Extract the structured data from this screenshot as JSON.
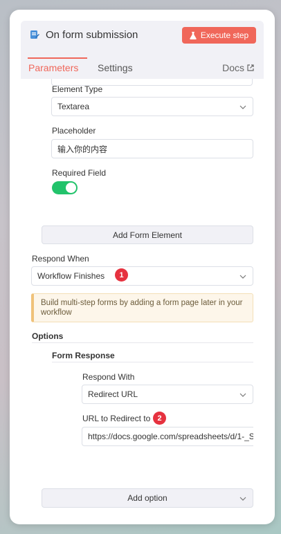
{
  "header": {
    "title": "On form submission",
    "execute_label": "Execute step",
    "tabs": [
      {
        "label": "Parameters",
        "active": true
      },
      {
        "label": "Settings",
        "active": false
      }
    ],
    "docs_label": "Docs"
  },
  "form_element": {
    "element_type_label": "Element Type",
    "element_type_value": "Textarea",
    "placeholder_label": "Placeholder",
    "placeholder_value": "输入你的内容",
    "required_label": "Required Field",
    "required_on": true
  },
  "add_form_element_label": "Add Form Element",
  "respond_when": {
    "label": "Respond When",
    "value": "Workflow Finishes",
    "badge": "1"
  },
  "notice": "Build multi-step forms by adding a form page later in your workflow",
  "options": {
    "title": "Options",
    "form_response_title": "Form Response",
    "respond_with_label": "Respond With",
    "respond_with_value": "Redirect URL",
    "redirect_label": "URL to Redirect to",
    "redirect_badge": "2",
    "redirect_value": "https://docs.google.com/spreadsheets/d/1-_S"
  },
  "add_option_label": "Add option",
  "colors": {
    "accent": "#f0675a",
    "toggle_on": "#22c36b",
    "badge": "#e6323f"
  }
}
